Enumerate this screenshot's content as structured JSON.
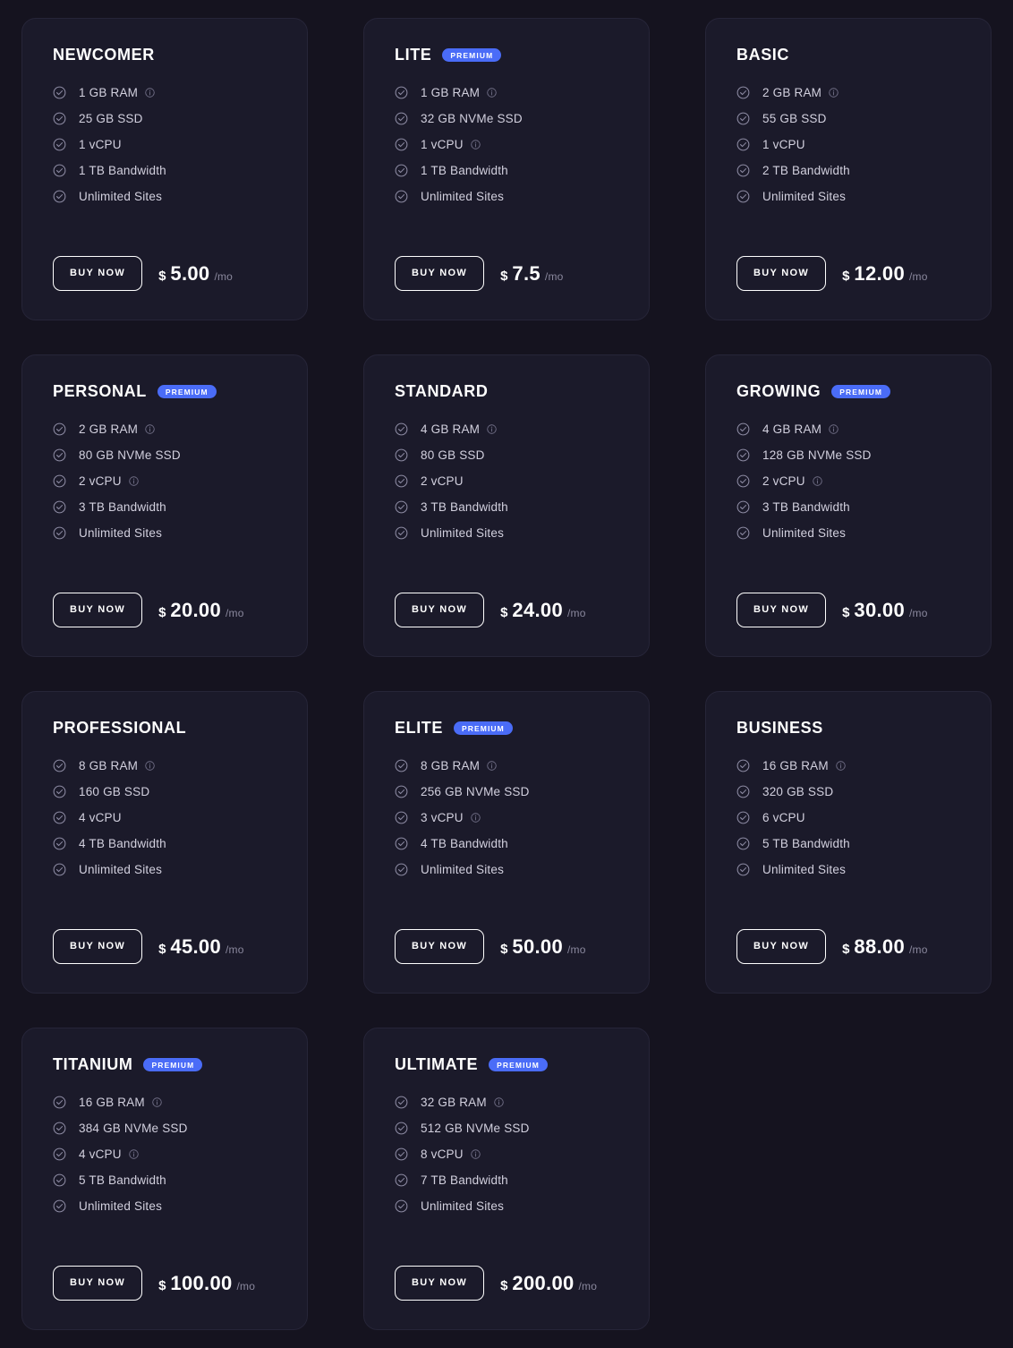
{
  "theme": {
    "page_background": "#15131f",
    "card_background": "#1b1a2a",
    "card_border": "#262538",
    "badge_accent": "#4a6cf7",
    "text_primary": "#ffffff",
    "text_feature": "#d2d0de",
    "text_muted": "#8a889d"
  },
  "labels": {
    "buy_now": "BUY NOW",
    "premium": "PREMIUM",
    "currency": "$",
    "period": "/mo",
    "check_icon": "check-circle-icon",
    "info_icon": "info-circle-icon"
  },
  "plans": [
    {
      "name": "NEWCOMER",
      "premium": false,
      "features": [
        {
          "text": "1 GB RAM",
          "info": true
        },
        {
          "text": "25 GB SSD",
          "info": false
        },
        {
          "text": "1 vCPU",
          "info": false
        },
        {
          "text": "1 TB Bandwidth",
          "info": false
        },
        {
          "text": "Unlimited Sites",
          "info": false
        }
      ],
      "price": "5.00"
    },
    {
      "name": "LITE",
      "premium": true,
      "features": [
        {
          "text": "1 GB RAM",
          "info": true
        },
        {
          "text": "32 GB NVMe SSD",
          "info": false
        },
        {
          "text": "1 vCPU",
          "info": true
        },
        {
          "text": "1 TB Bandwidth",
          "info": false
        },
        {
          "text": "Unlimited Sites",
          "info": false
        }
      ],
      "price": "7.5"
    },
    {
      "name": "BASIC",
      "premium": false,
      "features": [
        {
          "text": "2 GB RAM",
          "info": true
        },
        {
          "text": "55 GB SSD",
          "info": false
        },
        {
          "text": "1 vCPU",
          "info": false
        },
        {
          "text": "2 TB Bandwidth",
          "info": false
        },
        {
          "text": "Unlimited Sites",
          "info": false
        }
      ],
      "price": "12.00"
    },
    {
      "name": "PERSONAL",
      "premium": true,
      "features": [
        {
          "text": "2 GB RAM",
          "info": true
        },
        {
          "text": "80 GB NVMe SSD",
          "info": false
        },
        {
          "text": "2 vCPU",
          "info": true
        },
        {
          "text": "3 TB Bandwidth",
          "info": false
        },
        {
          "text": "Unlimited Sites",
          "info": false
        }
      ],
      "price": "20.00"
    },
    {
      "name": "STANDARD",
      "premium": false,
      "features": [
        {
          "text": "4 GB RAM",
          "info": true
        },
        {
          "text": "80 GB SSD",
          "info": false
        },
        {
          "text": "2 vCPU",
          "info": false
        },
        {
          "text": "3 TB Bandwidth",
          "info": false
        },
        {
          "text": "Unlimited Sites",
          "info": false
        }
      ],
      "price": "24.00"
    },
    {
      "name": "GROWING",
      "premium": true,
      "features": [
        {
          "text": "4 GB RAM",
          "info": true
        },
        {
          "text": "128 GB NVMe SSD",
          "info": false
        },
        {
          "text": "2 vCPU",
          "info": true
        },
        {
          "text": "3 TB Bandwidth",
          "info": false
        },
        {
          "text": "Unlimited Sites",
          "info": false
        }
      ],
      "price": "30.00"
    },
    {
      "name": "PROFESSIONAL",
      "premium": false,
      "features": [
        {
          "text": "8 GB RAM",
          "info": true
        },
        {
          "text": "160 GB SSD",
          "info": false
        },
        {
          "text": "4 vCPU",
          "info": false
        },
        {
          "text": "4 TB Bandwidth",
          "info": false
        },
        {
          "text": "Unlimited Sites",
          "info": false
        }
      ],
      "price": "45.00"
    },
    {
      "name": "ELITE",
      "premium": true,
      "features": [
        {
          "text": "8 GB RAM",
          "info": true
        },
        {
          "text": "256 GB NVMe SSD",
          "info": false
        },
        {
          "text": "3 vCPU",
          "info": true
        },
        {
          "text": "4 TB Bandwidth",
          "info": false
        },
        {
          "text": "Unlimited Sites",
          "info": false
        }
      ],
      "price": "50.00"
    },
    {
      "name": "BUSINESS",
      "premium": false,
      "features": [
        {
          "text": "16 GB RAM",
          "info": true
        },
        {
          "text": "320 GB SSD",
          "info": false
        },
        {
          "text": "6 vCPU",
          "info": false
        },
        {
          "text": "5 TB Bandwidth",
          "info": false
        },
        {
          "text": "Unlimited Sites",
          "info": false
        }
      ],
      "price": "88.00"
    },
    {
      "name": "TITANIUM",
      "premium": true,
      "features": [
        {
          "text": "16 GB RAM",
          "info": true
        },
        {
          "text": "384 GB NVMe SSD",
          "info": false
        },
        {
          "text": "4 vCPU",
          "info": true
        },
        {
          "text": "5 TB Bandwidth",
          "info": false
        },
        {
          "text": "Unlimited Sites",
          "info": false
        }
      ],
      "price": "100.00"
    },
    {
      "name": "ULTIMATE",
      "premium": true,
      "features": [
        {
          "text": "32 GB RAM",
          "info": true
        },
        {
          "text": "512 GB NVMe SSD",
          "info": false
        },
        {
          "text": "8 vCPU",
          "info": true
        },
        {
          "text": "7 TB Bandwidth",
          "info": false
        },
        {
          "text": "Unlimited Sites",
          "info": false
        }
      ],
      "price": "200.00"
    }
  ]
}
